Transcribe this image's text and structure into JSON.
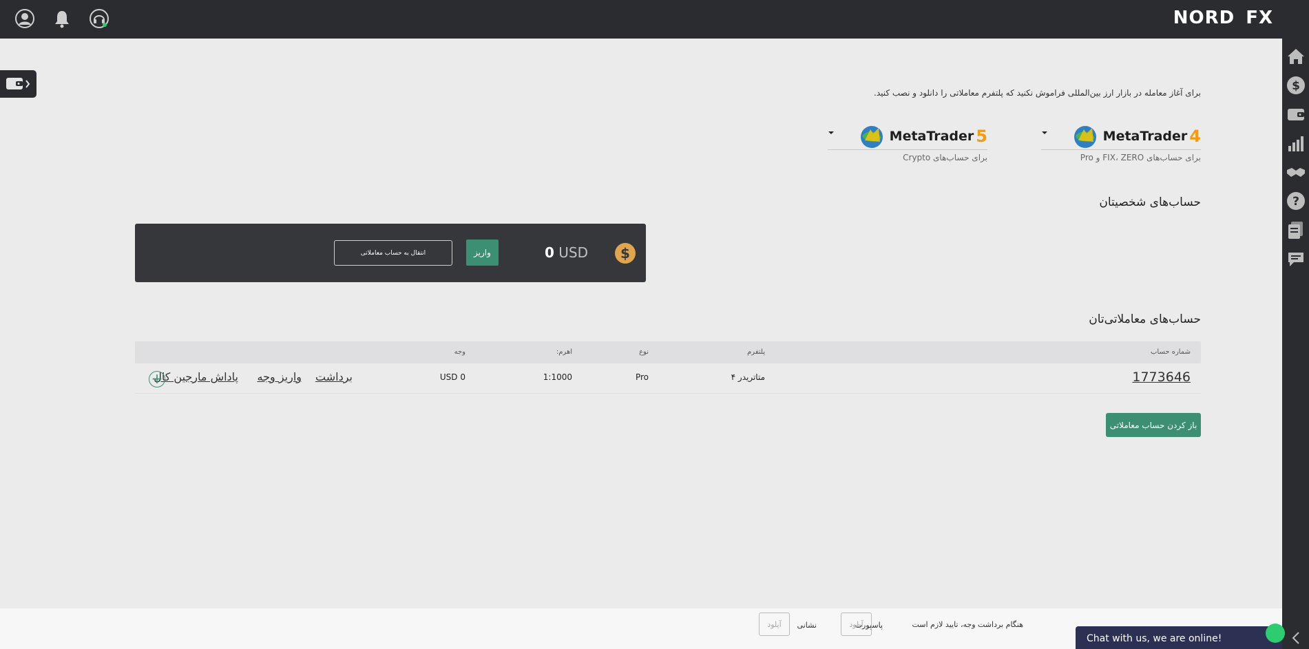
{
  "brand": {
    "logo_text": "NORD",
    "logo_fx": "FX"
  },
  "header": {
    "icons": [
      "user-icon",
      "bell-icon",
      "support-headset-icon"
    ]
  },
  "sidebar": {
    "icons": [
      "home-icon",
      "dollar-icon",
      "wallet-icon",
      "chart-icon",
      "handshake-icon",
      "help-icon",
      "document-icon",
      "chat-icon"
    ]
  },
  "intro_text": "برای آغاز معامله در بازار ارز بین‌المللی فراموش نکنید که پلتفرم معاملاتی را دانلود و نصب کنید.",
  "platforms": [
    {
      "name": "MetaTrader",
      "version": "4",
      "subtitle": "برای حساب‌های FIX، ZERO و Pro"
    },
    {
      "name": "MetaTrader",
      "version": "5",
      "subtitle": "برای حساب‌های Crypto"
    }
  ],
  "personal": {
    "title": "حساب‌های شخصیتان",
    "balance_amount": "0",
    "balance_currency": "USD",
    "deposit_label": "واریز",
    "transfer_label": "انتقال به حساب معاملاتی"
  },
  "trading": {
    "title": "حساب‌های معاملاتی‌تان",
    "columns": {
      "account": "شماره حساب",
      "platform": "پلتفرم",
      "type": "نوع",
      "leverage": "اهرم:",
      "funds": "وجه"
    },
    "rows": [
      {
        "account": "1773646",
        "platform": "متاتریدر ۴",
        "type": "Pro",
        "leverage": "1:1000",
        "funds": "0 USD",
        "links": {
          "withdraw": "برداشت",
          "deposit": "واریز وجه",
          "bonus": "پاداش مارجین کال"
        }
      }
    ],
    "open_account_label": "باز کردن حساب معاملاتی"
  },
  "footer": {
    "note": "هنگام برداشت وجه، تایید لازم است",
    "passport_label": "پاسپورت",
    "address_label": "نشانی",
    "upload_label": "آپلود"
  },
  "chat": {
    "text": "Chat with us, we are online!"
  },
  "colors": {
    "dark": "#2b2c2f",
    "accent": "#3d8f73",
    "coin": "#e0a64f"
  }
}
